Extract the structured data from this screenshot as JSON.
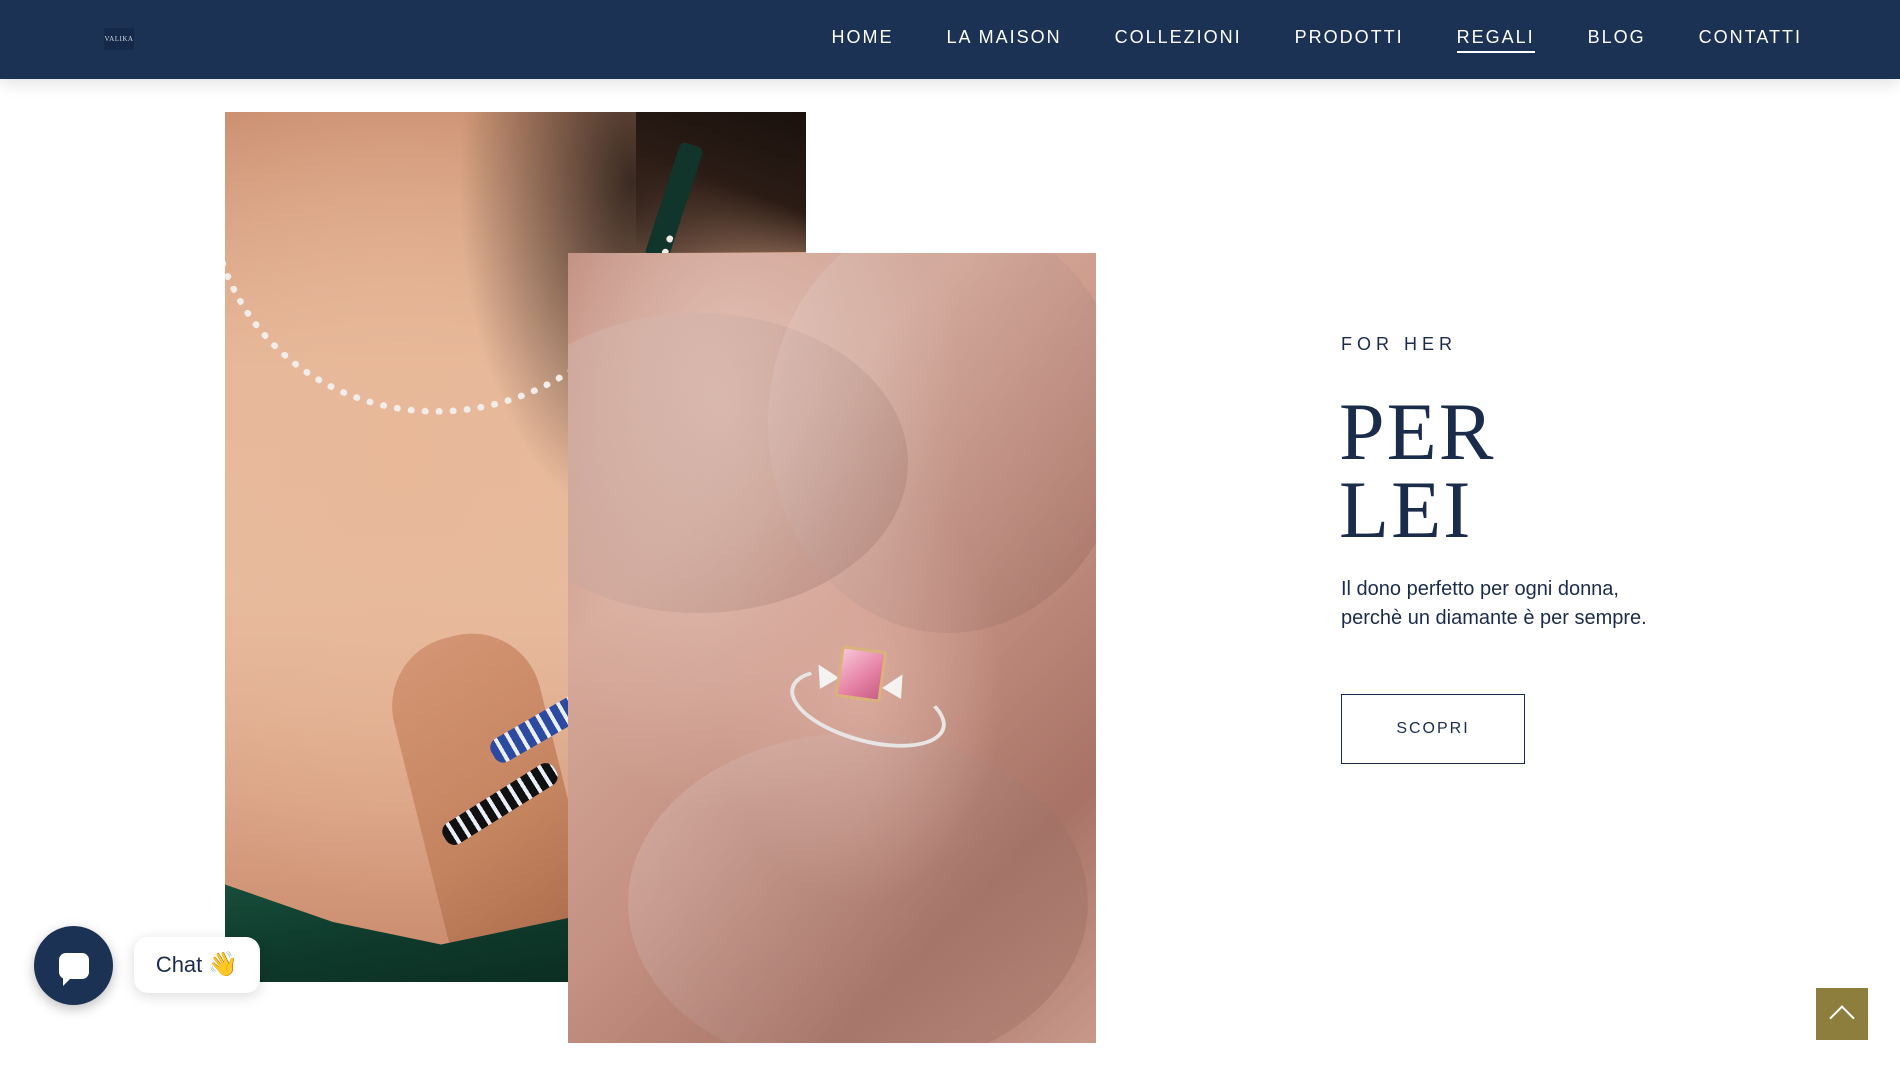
{
  "header": {
    "logo_text": "VALIKA",
    "nav": [
      {
        "label": "HOME",
        "active": false
      },
      {
        "label": "LA MAISON",
        "active": false
      },
      {
        "label": "COLLEZIONI",
        "active": false
      },
      {
        "label": "PRODOTTI",
        "active": false
      },
      {
        "label": "REGALI",
        "active": true
      },
      {
        "label": "BLOG",
        "active": false
      },
      {
        "label": "CONTATTI",
        "active": false
      }
    ]
  },
  "hero": {
    "eyebrow": "FOR HER",
    "headline_line1": "PER",
    "headline_line2": "LEI",
    "description_line1": "Il dono perfetto per ogni donna,",
    "description_line2": "perchè un diamante è per sempre.",
    "cta_label": "SCOPRI"
  },
  "chat": {
    "label": "Chat",
    "emoji": "👋"
  },
  "colors": {
    "header_bg": "#1b3254",
    "text": "#1b2c4b",
    "scroll_top_bg": "#8e7e3e"
  }
}
